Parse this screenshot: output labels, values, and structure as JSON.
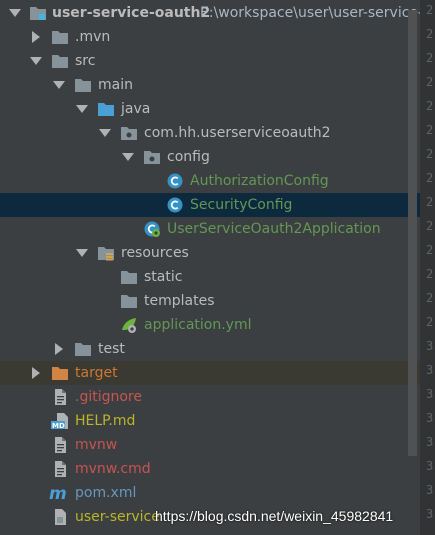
{
  "root": {
    "name": "user-service-oauth2",
    "path": "E:\\workspace\\user\\user-service-o"
  },
  "items": {
    "mvn": ".mvn",
    "src": "src",
    "main": "main",
    "java": "java",
    "pkg": "com.hh.userserviceoauth2",
    "config": "config",
    "auth": "AuthorizationConfig",
    "security": "SecurityConfig",
    "app": "UserServiceOauth2Application",
    "resources": "resources",
    "static": "static",
    "templates": "templates",
    "yml": "application.yml",
    "test": "test",
    "target": "target",
    "gitignore": ".gitignore",
    "help": "HELP.md",
    "mvnw": "mvnw",
    "mvnwcmd": "mvnw.cmd",
    "pom": "pom.xml",
    "iml": "user-service"
  },
  "icon_badges": {
    "md": "MD",
    "maven": "m"
  },
  "watermark": "https://blog.csdn.net/weixin_45982841",
  "gutter": [
    "2",
    "2",
    "2",
    "2",
    "2",
    "2",
    "2",
    "2",
    "2",
    "2",
    "2",
    "2",
    "2",
    "2",
    "3",
    "3",
    "3",
    "3",
    "3",
    "3",
    "3",
    "3"
  ]
}
